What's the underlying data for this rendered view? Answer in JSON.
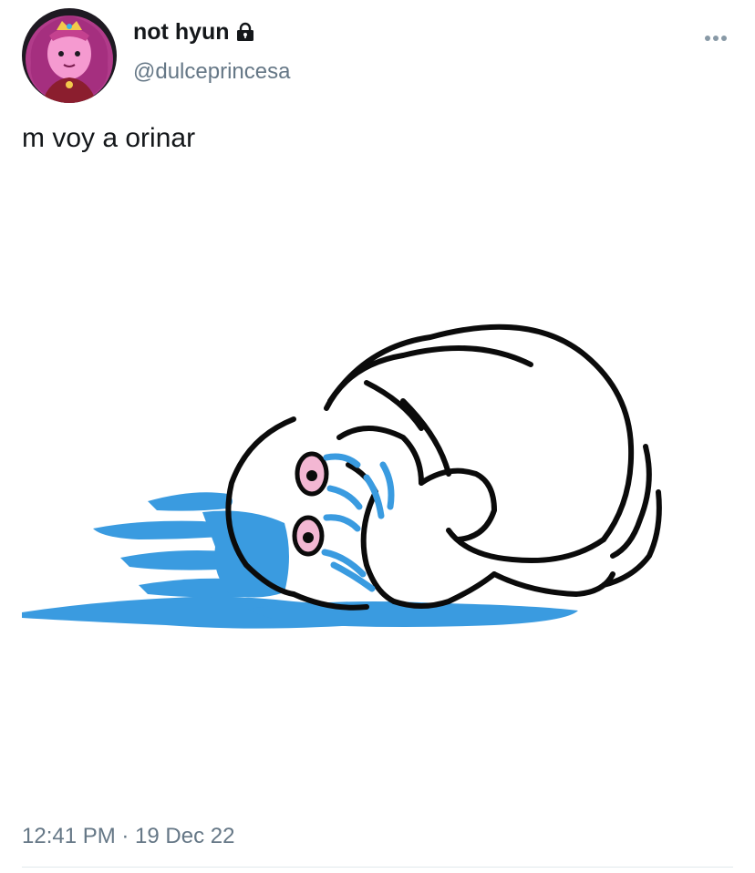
{
  "tweet": {
    "author": {
      "display_name": "not hyun",
      "handle": "@dulceprincesa",
      "protected": true,
      "avatar_icon": "princess-bubblegum-avatar"
    },
    "text": "m voy a orinar",
    "media_icon": "crying-face-down-meme-image",
    "timestamp": "12:41 PM · 19 Dec 22",
    "more_icon": "more-options-icon"
  },
  "colors": {
    "text_primary": "#14171a",
    "text_secondary": "#657786",
    "tears": "#3a9be0",
    "divider": "#e1e8ed"
  }
}
